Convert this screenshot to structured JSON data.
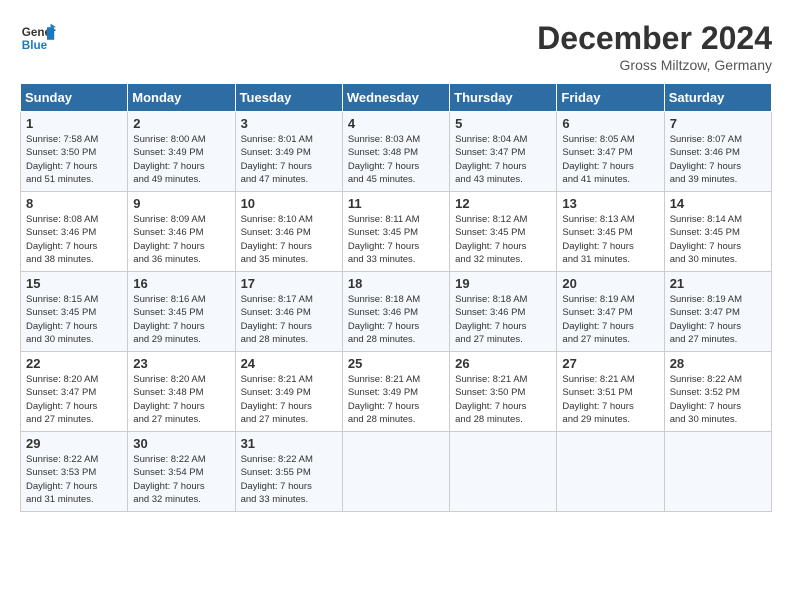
{
  "header": {
    "logo_line1": "General",
    "logo_line2": "Blue",
    "month": "December 2024",
    "location": "Gross Miltzow, Germany"
  },
  "days_of_week": [
    "Sunday",
    "Monday",
    "Tuesday",
    "Wednesday",
    "Thursday",
    "Friday",
    "Saturday"
  ],
  "weeks": [
    [
      {
        "day": "1",
        "info": "Sunrise: 7:58 AM\nSunset: 3:50 PM\nDaylight: 7 hours\nand 51 minutes."
      },
      {
        "day": "2",
        "info": "Sunrise: 8:00 AM\nSunset: 3:49 PM\nDaylight: 7 hours\nand 49 minutes."
      },
      {
        "day": "3",
        "info": "Sunrise: 8:01 AM\nSunset: 3:49 PM\nDaylight: 7 hours\nand 47 minutes."
      },
      {
        "day": "4",
        "info": "Sunrise: 8:03 AM\nSunset: 3:48 PM\nDaylight: 7 hours\nand 45 minutes."
      },
      {
        "day": "5",
        "info": "Sunrise: 8:04 AM\nSunset: 3:47 PM\nDaylight: 7 hours\nand 43 minutes."
      },
      {
        "day": "6",
        "info": "Sunrise: 8:05 AM\nSunset: 3:47 PM\nDaylight: 7 hours\nand 41 minutes."
      },
      {
        "day": "7",
        "info": "Sunrise: 8:07 AM\nSunset: 3:46 PM\nDaylight: 7 hours\nand 39 minutes."
      }
    ],
    [
      {
        "day": "8",
        "info": "Sunrise: 8:08 AM\nSunset: 3:46 PM\nDaylight: 7 hours\nand 38 minutes."
      },
      {
        "day": "9",
        "info": "Sunrise: 8:09 AM\nSunset: 3:46 PM\nDaylight: 7 hours\nand 36 minutes."
      },
      {
        "day": "10",
        "info": "Sunrise: 8:10 AM\nSunset: 3:46 PM\nDaylight: 7 hours\nand 35 minutes."
      },
      {
        "day": "11",
        "info": "Sunrise: 8:11 AM\nSunset: 3:45 PM\nDaylight: 7 hours\nand 33 minutes."
      },
      {
        "day": "12",
        "info": "Sunrise: 8:12 AM\nSunset: 3:45 PM\nDaylight: 7 hours\nand 32 minutes."
      },
      {
        "day": "13",
        "info": "Sunrise: 8:13 AM\nSunset: 3:45 PM\nDaylight: 7 hours\nand 31 minutes."
      },
      {
        "day": "14",
        "info": "Sunrise: 8:14 AM\nSunset: 3:45 PM\nDaylight: 7 hours\nand 30 minutes."
      }
    ],
    [
      {
        "day": "15",
        "info": "Sunrise: 8:15 AM\nSunset: 3:45 PM\nDaylight: 7 hours\nand 30 minutes."
      },
      {
        "day": "16",
        "info": "Sunrise: 8:16 AM\nSunset: 3:45 PM\nDaylight: 7 hours\nand 29 minutes."
      },
      {
        "day": "17",
        "info": "Sunrise: 8:17 AM\nSunset: 3:46 PM\nDaylight: 7 hours\nand 28 minutes."
      },
      {
        "day": "18",
        "info": "Sunrise: 8:18 AM\nSunset: 3:46 PM\nDaylight: 7 hours\nand 28 minutes."
      },
      {
        "day": "19",
        "info": "Sunrise: 8:18 AM\nSunset: 3:46 PM\nDaylight: 7 hours\nand 27 minutes."
      },
      {
        "day": "20",
        "info": "Sunrise: 8:19 AM\nSunset: 3:47 PM\nDaylight: 7 hours\nand 27 minutes."
      },
      {
        "day": "21",
        "info": "Sunrise: 8:19 AM\nSunset: 3:47 PM\nDaylight: 7 hours\nand 27 minutes."
      }
    ],
    [
      {
        "day": "22",
        "info": "Sunrise: 8:20 AM\nSunset: 3:47 PM\nDaylight: 7 hours\nand 27 minutes."
      },
      {
        "day": "23",
        "info": "Sunrise: 8:20 AM\nSunset: 3:48 PM\nDaylight: 7 hours\nand 27 minutes."
      },
      {
        "day": "24",
        "info": "Sunrise: 8:21 AM\nSunset: 3:49 PM\nDaylight: 7 hours\nand 27 minutes."
      },
      {
        "day": "25",
        "info": "Sunrise: 8:21 AM\nSunset: 3:49 PM\nDaylight: 7 hours\nand 28 minutes."
      },
      {
        "day": "26",
        "info": "Sunrise: 8:21 AM\nSunset: 3:50 PM\nDaylight: 7 hours\nand 28 minutes."
      },
      {
        "day": "27",
        "info": "Sunrise: 8:21 AM\nSunset: 3:51 PM\nDaylight: 7 hours\nand 29 minutes."
      },
      {
        "day": "28",
        "info": "Sunrise: 8:22 AM\nSunset: 3:52 PM\nDaylight: 7 hours\nand 30 minutes."
      }
    ],
    [
      {
        "day": "29",
        "info": "Sunrise: 8:22 AM\nSunset: 3:53 PM\nDaylight: 7 hours\nand 31 minutes."
      },
      {
        "day": "30",
        "info": "Sunrise: 8:22 AM\nSunset: 3:54 PM\nDaylight: 7 hours\nand 32 minutes."
      },
      {
        "day": "31",
        "info": "Sunrise: 8:22 AM\nSunset: 3:55 PM\nDaylight: 7 hours\nand 33 minutes."
      },
      {
        "day": "",
        "info": ""
      },
      {
        "day": "",
        "info": ""
      },
      {
        "day": "",
        "info": ""
      },
      {
        "day": "",
        "info": ""
      }
    ]
  ]
}
